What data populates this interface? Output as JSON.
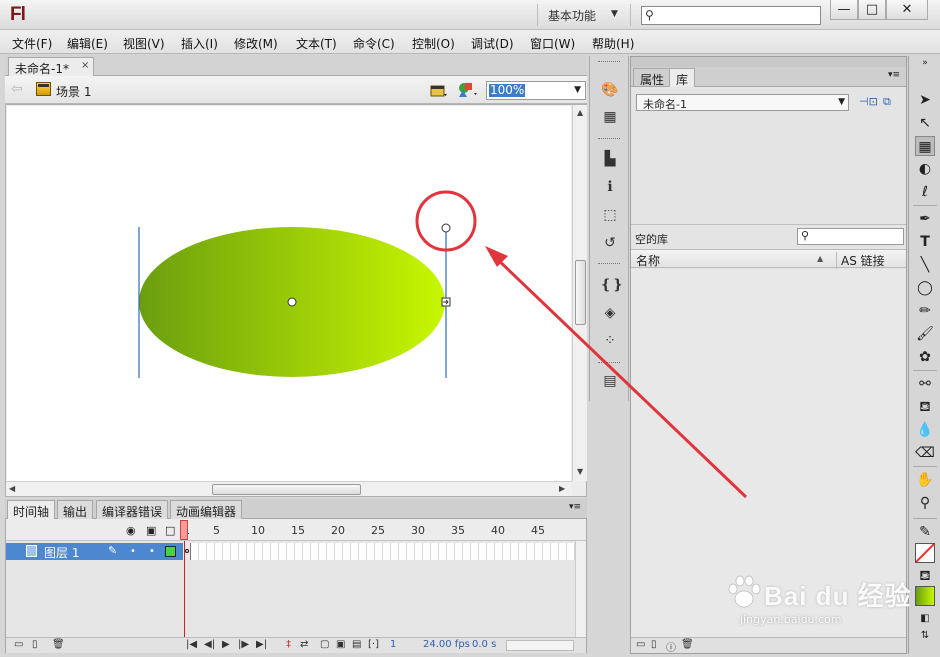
{
  "app": {
    "logo": "Fl",
    "workspace": "基本功能"
  },
  "window": {
    "minimize": "—",
    "maximize": "□",
    "close": "✕"
  },
  "menu": [
    "文件(F)",
    "编辑(E)",
    "视图(V)",
    "插入(I)",
    "修改(M)",
    "文本(T)",
    "命令(C)",
    "控制(O)",
    "调试(D)",
    "窗口(W)",
    "帮助(H)"
  ],
  "document": {
    "tab_title": "未命名-1*",
    "tab_close": "×",
    "scene": "场景 1",
    "zoom": "100%"
  },
  "stage": {
    "shape": "ellipse",
    "gradient_start": "#6b9e0f",
    "gradient_end": "#c8f700",
    "annotation_color": "#e0353c"
  },
  "timeline": {
    "tabs": [
      "时间轴",
      "输出",
      "编译器错误",
      "动画编辑器"
    ],
    "frame_numbers": [
      "1",
      "5",
      "10",
      "15",
      "20",
      "25",
      "30",
      "35",
      "40",
      "45"
    ],
    "layer_name": "图层 1",
    "current_frame": "1",
    "fps": "24.00 fps",
    "time": "0.0 s",
    "layer_color": "#48d048"
  },
  "panel": {
    "tabs": [
      "属性",
      "库"
    ],
    "doc_select": "未命名-1",
    "library_status": "空的库",
    "columns": {
      "name": "名称",
      "linkage": "AS 链接"
    }
  },
  "watermark": {
    "text": "Bai du 经验",
    "sub": "jingyan.baidu.com"
  }
}
